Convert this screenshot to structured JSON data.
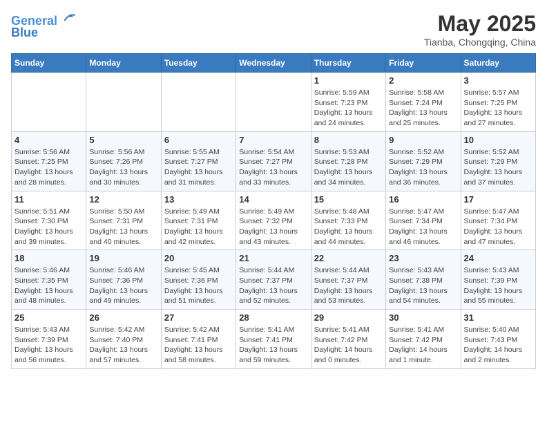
{
  "header": {
    "logo_line1": "General",
    "logo_line2": "Blue",
    "month": "May 2025",
    "location": "Tianba, Chongqing, China"
  },
  "weekdays": [
    "Sunday",
    "Monday",
    "Tuesday",
    "Wednesday",
    "Thursday",
    "Friday",
    "Saturday"
  ],
  "weeks": [
    [
      {
        "day": "",
        "info": ""
      },
      {
        "day": "",
        "info": ""
      },
      {
        "day": "",
        "info": ""
      },
      {
        "day": "",
        "info": ""
      },
      {
        "day": "1",
        "info": "Sunrise: 5:59 AM\nSunset: 7:23 PM\nDaylight: 13 hours and 24 minutes."
      },
      {
        "day": "2",
        "info": "Sunrise: 5:58 AM\nSunset: 7:24 PM\nDaylight: 13 hours and 25 minutes."
      },
      {
        "day": "3",
        "info": "Sunrise: 5:57 AM\nSunset: 7:25 PM\nDaylight: 13 hours and 27 minutes."
      }
    ],
    [
      {
        "day": "4",
        "info": "Sunrise: 5:56 AM\nSunset: 7:25 PM\nDaylight: 13 hours and 28 minutes."
      },
      {
        "day": "5",
        "info": "Sunrise: 5:56 AM\nSunset: 7:26 PM\nDaylight: 13 hours and 30 minutes."
      },
      {
        "day": "6",
        "info": "Sunrise: 5:55 AM\nSunset: 7:27 PM\nDaylight: 13 hours and 31 minutes."
      },
      {
        "day": "7",
        "info": "Sunrise: 5:54 AM\nSunset: 7:27 PM\nDaylight: 13 hours and 33 minutes."
      },
      {
        "day": "8",
        "info": "Sunrise: 5:53 AM\nSunset: 7:28 PM\nDaylight: 13 hours and 34 minutes."
      },
      {
        "day": "9",
        "info": "Sunrise: 5:52 AM\nSunset: 7:29 PM\nDaylight: 13 hours and 36 minutes."
      },
      {
        "day": "10",
        "info": "Sunrise: 5:52 AM\nSunset: 7:29 PM\nDaylight: 13 hours and 37 minutes."
      }
    ],
    [
      {
        "day": "11",
        "info": "Sunrise: 5:51 AM\nSunset: 7:30 PM\nDaylight: 13 hours and 39 minutes."
      },
      {
        "day": "12",
        "info": "Sunrise: 5:50 AM\nSunset: 7:31 PM\nDaylight: 13 hours and 40 minutes."
      },
      {
        "day": "13",
        "info": "Sunrise: 5:49 AM\nSunset: 7:31 PM\nDaylight: 13 hours and 42 minutes."
      },
      {
        "day": "14",
        "info": "Sunrise: 5:49 AM\nSunset: 7:32 PM\nDaylight: 13 hours and 43 minutes."
      },
      {
        "day": "15",
        "info": "Sunrise: 5:48 AM\nSunset: 7:33 PM\nDaylight: 13 hours and 44 minutes."
      },
      {
        "day": "16",
        "info": "Sunrise: 5:47 AM\nSunset: 7:34 PM\nDaylight: 13 hours and 46 minutes."
      },
      {
        "day": "17",
        "info": "Sunrise: 5:47 AM\nSunset: 7:34 PM\nDaylight: 13 hours and 47 minutes."
      }
    ],
    [
      {
        "day": "18",
        "info": "Sunrise: 5:46 AM\nSunset: 7:35 PM\nDaylight: 13 hours and 48 minutes."
      },
      {
        "day": "19",
        "info": "Sunrise: 5:46 AM\nSunset: 7:36 PM\nDaylight: 13 hours and 49 minutes."
      },
      {
        "day": "20",
        "info": "Sunrise: 5:45 AM\nSunset: 7:36 PM\nDaylight: 13 hours and 51 minutes."
      },
      {
        "day": "21",
        "info": "Sunrise: 5:44 AM\nSunset: 7:37 PM\nDaylight: 13 hours and 52 minutes."
      },
      {
        "day": "22",
        "info": "Sunrise: 5:44 AM\nSunset: 7:37 PM\nDaylight: 13 hours and 53 minutes."
      },
      {
        "day": "23",
        "info": "Sunrise: 5:43 AM\nSunset: 7:38 PM\nDaylight: 13 hours and 54 minutes."
      },
      {
        "day": "24",
        "info": "Sunrise: 5:43 AM\nSunset: 7:39 PM\nDaylight: 13 hours and 55 minutes."
      }
    ],
    [
      {
        "day": "25",
        "info": "Sunrise: 5:43 AM\nSunset: 7:39 PM\nDaylight: 13 hours and 56 minutes."
      },
      {
        "day": "26",
        "info": "Sunrise: 5:42 AM\nSunset: 7:40 PM\nDaylight: 13 hours and 57 minutes."
      },
      {
        "day": "27",
        "info": "Sunrise: 5:42 AM\nSunset: 7:41 PM\nDaylight: 13 hours and 58 minutes."
      },
      {
        "day": "28",
        "info": "Sunrise: 5:41 AM\nSunset: 7:41 PM\nDaylight: 13 hours and 59 minutes."
      },
      {
        "day": "29",
        "info": "Sunrise: 5:41 AM\nSunset: 7:42 PM\nDaylight: 14 hours and 0 minutes."
      },
      {
        "day": "30",
        "info": "Sunrise: 5:41 AM\nSunset: 7:42 PM\nDaylight: 14 hours and 1 minute."
      },
      {
        "day": "31",
        "info": "Sunrise: 5:40 AM\nSunset: 7:43 PM\nDaylight: 14 hours and 2 minutes."
      }
    ]
  ]
}
